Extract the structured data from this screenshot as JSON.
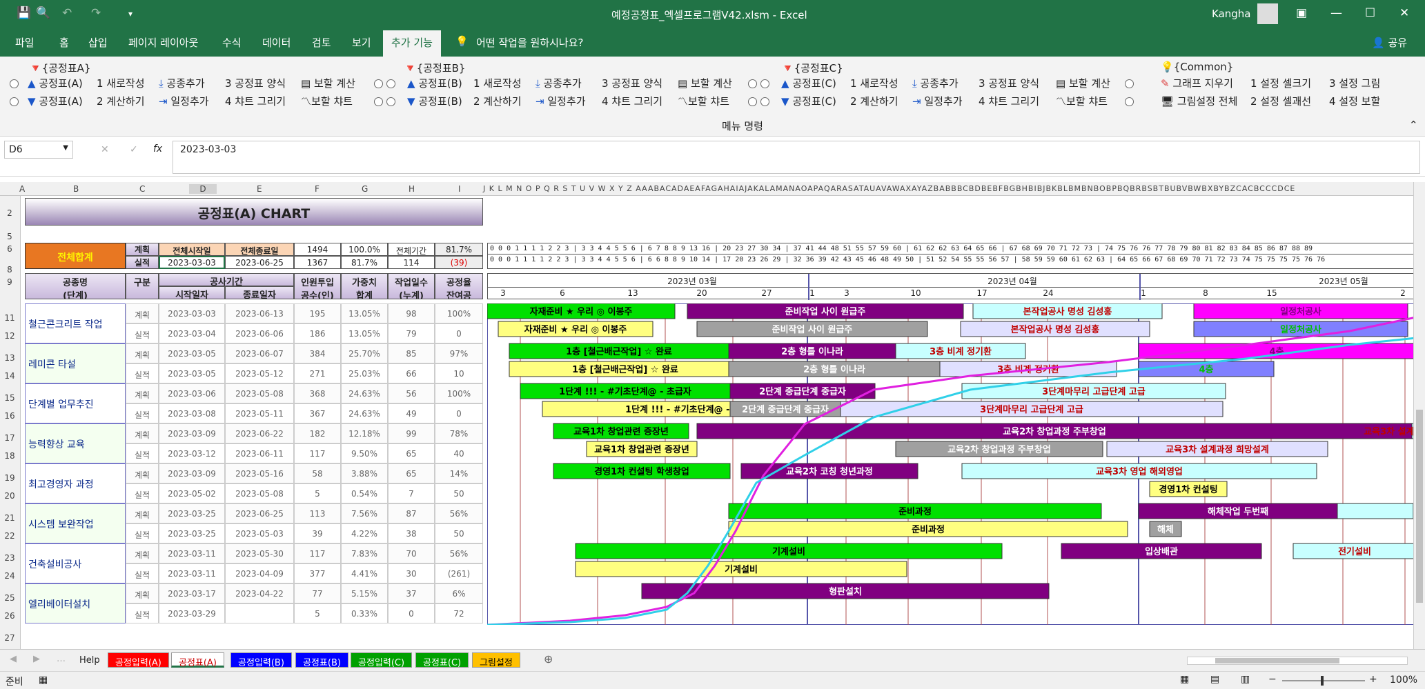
{
  "title_bar": {
    "filename": "예정공정표_엑셀프로그램V42.xlsm",
    "sep": "-",
    "app": "Excel",
    "user": "Kangha"
  },
  "ribbon_tabs": [
    "파일",
    "홈",
    "삽입",
    "페이지 레이아웃",
    "수식",
    "데이터",
    "검토",
    "보기",
    "추가 기능"
  ],
  "tell_me": "어떤 작업을 원하시나요?",
  "share": "공유",
  "groups": [
    {
      "title": "{공정표A}",
      "row1": [
        "공정표(A)",
        "1 새로작성",
        "공종추가",
        "3 공정표 양식",
        "보할 계산"
      ],
      "row2": [
        "공정표(A)",
        "2 계산하기",
        "일정추가",
        "4 챠트 그리기",
        "보할 챠트"
      ]
    },
    {
      "title": "{공정표B}",
      "row1": [
        "공정표(B)",
        "1 새로작성",
        "공종추가",
        "3 공정표 양식",
        "보할 계산"
      ],
      "row2": [
        "공정표(B)",
        "2 계산하기",
        "일정추가",
        "4 챠트 그리기",
        "보할 챠트"
      ]
    },
    {
      "title": "{공정표C}",
      "row1": [
        "공정표(C)",
        "1 새로작성",
        "공종추가",
        "3 공정표 양식",
        "보할 계산"
      ],
      "row2": [
        "공정표(C)",
        "2 계산하기",
        "일정추가",
        "4 챠트 그리기",
        "보할 챠트"
      ]
    },
    {
      "title": "{Common}",
      "row1": [
        "그래프 지우기",
        "1 설정 셀크기",
        "3 설정 그림"
      ],
      "row2": [
        "그림설정 전체",
        "2 설정 셀괘선",
        "4 설정 보할"
      ]
    }
  ],
  "ribbon_footer": "메뉴 명령",
  "namebox": "D6",
  "formula": "2023-03-03",
  "sheet_title": "공정표(A) CHART",
  "summary": {
    "label": "전체합계",
    "plan_label": "계획",
    "actual_label": "실적",
    "h_start": "전체시작일",
    "h_end": "전체종료일",
    "plan_start": "2023-03-03",
    "actual_start": "2023-03-03",
    "actual_end": "2023-06-25",
    "plan_f": "1494",
    "plan_g": "100.0%",
    "period_label": "전체기간",
    "plan_pct": "81.7%",
    "act_f": "1367",
    "act_g": "81.7%",
    "act_h": "114",
    "act_i": "(39)"
  },
  "headers": {
    "name1": "공종명",
    "name2": "(단계)",
    "div": "구분",
    "period": "공사기간",
    "start": "시작일자",
    "end": "종료일자",
    "inp1": "인원투입",
    "inp2": "공수(인)",
    "w1": "가중치",
    "w2": "합계",
    "days1": "작업일수",
    "days2": "(누계)",
    "rate1": "공정율",
    "rate2": "잔여공"
  },
  "tasks": [
    {
      "name": "철근콘크리트 작업",
      "plan": [
        "계획",
        "2023-03-03",
        "2023-06-13",
        "195",
        "13.05%",
        "98",
        "100%"
      ],
      "act": [
        "실적",
        "2023-03-04",
        "2023-06-06",
        "186",
        "13.05%",
        "79",
        "0"
      ]
    },
    {
      "name": "레미콘 타설",
      "plan": [
        "계획",
        "2023-03-05",
        "2023-06-07",
        "384",
        "25.70%",
        "85",
        "97%"
      ],
      "act": [
        "실적",
        "2023-03-05",
        "2023-05-12",
        "271",
        "25.03%",
        "66",
        "10"
      ]
    },
    {
      "name": "단계별 업무추진",
      "plan": [
        "계획",
        "2023-03-06",
        "2023-05-08",
        "368",
        "24.63%",
        "56",
        "100%"
      ],
      "act": [
        "실적",
        "2023-03-08",
        "2023-05-11",
        "367",
        "24.63%",
        "49",
        "0"
      ]
    },
    {
      "name": "능력향상 교육",
      "plan": [
        "계획",
        "2023-03-09",
        "2023-06-22",
        "182",
        "12.18%",
        "99",
        "78%"
      ],
      "act": [
        "실적",
        "2023-03-12",
        "2023-06-11",
        "117",
        "9.50%",
        "65",
        "40"
      ]
    },
    {
      "name": "최고경영자 과정",
      "plan": [
        "계획",
        "2023-03-09",
        "2023-05-16",
        "58",
        "3.88%",
        "65",
        "14%"
      ],
      "act": [
        "실적",
        "2023-05-02",
        "2023-05-08",
        "5",
        "0.54%",
        "7",
        "50"
      ]
    },
    {
      "name": "시스템 보완작업",
      "plan": [
        "계획",
        "2023-03-25",
        "2023-06-25",
        "113",
        "7.56%",
        "87",
        "56%"
      ],
      "act": [
        "실적",
        "2023-03-25",
        "2023-05-03",
        "39",
        "4.22%",
        "38",
        "50"
      ]
    },
    {
      "name": "건축설비공사",
      "plan": [
        "계획",
        "2023-03-11",
        "2023-05-30",
        "117",
        "7.83%",
        "70",
        "56%"
      ],
      "act": [
        "실적",
        "2023-03-11",
        "2023-04-09",
        "377",
        "4.41%",
        "30",
        "(261)"
      ]
    },
    {
      "name": "엘리베이터설치",
      "plan": [
        "계획",
        "2023-03-17",
        "2023-04-22",
        "77",
        "5.15%",
        "37",
        "6%"
      ],
      "act": [
        "실적",
        "2023-03-29",
        "",
        "5",
        "0.33%",
        "0",
        "72"
      ]
    }
  ],
  "months": [
    "2023년 03월",
    "2023년 04월",
    "2023년 05월"
  ],
  "days": [
    "3",
    "6",
    "13",
    "20",
    "27",
    "1",
    "3",
    "10",
    "17",
    "24",
    "1",
    "8",
    "15",
    "2"
  ],
  "bars": [
    {
      "text": "자재준비 ★ 우리 ◎ 이봉주",
      "color": "#00e000",
      "fg": "#000"
    },
    {
      "text": "준비작업 사이 원급주",
      "color": "#800080",
      "fg": "#fff"
    },
    {
      "text": "본작업공사 명성 김성홍",
      "color": "#c8ffff",
      "fg": "#c00000"
    },
    {
      "text": "일정처공사",
      "color": "#ff00ff",
      "fg": "#800080"
    },
    {
      "text": "자재준비 ★ 우리 ◎ 이봉주",
      "color": "#ffff80",
      "fg": "#000"
    },
    {
      "text": "준비작업 사이 원급주",
      "color": "#a0a0a0",
      "fg": "#fff"
    },
    {
      "text": "본작업공사 명성 김성홍",
      "color": "#e0e0ff",
      "fg": "#c00000"
    },
    {
      "text": "일정처공사",
      "color": "#8080ff",
      "fg": "#00c000"
    },
    {
      "text": "1층 [철근배근작업] ☆ 완료",
      "color": "#00e000",
      "fg": "#000"
    },
    {
      "text": "2층 형틀 이나라",
      "color": "#800080",
      "fg": "#fff"
    },
    {
      "text": "3층 비계 정기환",
      "color": "#c8ffff",
      "fg": "#c00000"
    },
    {
      "text": "4층",
      "color": "#ff00ff",
      "fg": "#800080"
    },
    {
      "text": "1층 [철근배근작업] ☆ 완료",
      "color": "#ffff80",
      "fg": "#000"
    },
    {
      "text": "2층 형틀 이나라",
      "color": "#a0a0a0",
      "fg": "#fff"
    },
    {
      "text": "3층 비계 정기환",
      "color": "#e0e0ff",
      "fg": "#c00000"
    },
    {
      "text": "4층",
      "color": "#8080ff",
      "fg": "#00c000"
    },
    {
      "text": "1단계 !!! - #기초단계@ - 초급자",
      "color": "#00e000",
      "fg": "#000"
    },
    {
      "text": "2단계 중급단계 중급자",
      "color": "#800080",
      "fg": "#fff"
    },
    {
      "text": "3단계마무리 고급단계 고급",
      "color": "#c8ffff",
      "fg": "#c00000"
    },
    {
      "text": "1단계 !!! - #기초단계@ - 초급자",
      "color": "#ffff80",
      "fg": "#000"
    },
    {
      "text": "2단계 중급단계 중급자",
      "color": "#a0a0a0",
      "fg": "#fff"
    },
    {
      "text": "3단계마무리 고급단계 고급",
      "color": "#e0e0ff",
      "fg": "#c00000"
    },
    {
      "text": "교육1차 창업관련 증장년",
      "color": "#00e000",
      "fg": "#000"
    },
    {
      "text": "교육2차 창업과정 주부창업",
      "color": "#800080",
      "fg": "#fff"
    },
    {
      "text": "교육3차 설계과정 희망설계",
      "color": "#c8ffff",
      "fg": "#c00000"
    },
    {
      "text": "교육1차 창업관련 증장년",
      "color": "#ffff80",
      "fg": "#000"
    },
    {
      "text": "교육2차 창업과정 주부창업",
      "color": "#a0a0a0",
      "fg": "#fff"
    },
    {
      "text": "교육3차 설계과정 희망설계",
      "color": "#e0e0ff",
      "fg": "#c00000"
    },
    {
      "text": "경영1차 컨설팅 학생창업",
      "color": "#00e000",
      "fg": "#000"
    },
    {
      "text": "교육2차 코칭 청년과정",
      "color": "#800080",
      "fg": "#fff"
    },
    {
      "text": "교육3차 영업 해외영업",
      "color": "#c8ffff",
      "fg": "#c00000"
    },
    {
      "text": "경영1차 컨설팅",
      "color": "#ffff80",
      "fg": "#000"
    },
    {
      "text": "준비과정",
      "color": "#00e000",
      "fg": "#000"
    },
    {
      "text": "해체작업 두번째",
      "color": "#800080",
      "fg": "#fff"
    },
    {
      "text": "준비과정",
      "color": "#ffff80",
      "fg": "#000"
    },
    {
      "text": "해체",
      "color": "#a0a0a0",
      "fg": "#fff"
    },
    {
      "text": "기계설비",
      "color": "#00e000",
      "fg": "#000"
    },
    {
      "text": "입상배관",
      "color": "#800080",
      "fg": "#fff"
    },
    {
      "text": "전기설비",
      "color": "#c8ffff",
      "fg": "#c00000"
    },
    {
      "text": "기계설비",
      "color": "#ffff80",
      "fg": "#000"
    },
    {
      "text": "형판설치",
      "color": "#800080",
      "fg": "#fff"
    }
  ],
  "sheet_tabs": [
    "Help",
    "공정입력(A)",
    "공정표(A)",
    "공정입력(B)",
    "공정표(B)",
    "공정입력(C)",
    "공정표(C)",
    "그림설정"
  ],
  "status": {
    "ready": "준비",
    "zoom": "100%"
  }
}
